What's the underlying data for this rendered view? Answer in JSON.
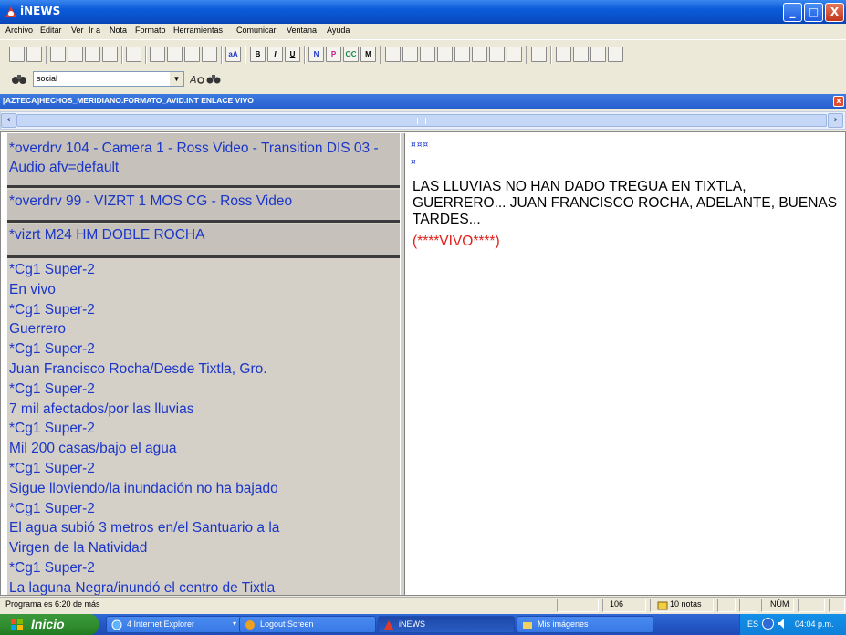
{
  "window": {
    "title": "iNEWS",
    "controls": {
      "minimize": "_",
      "maximize": "□",
      "close": "X"
    }
  },
  "menu": [
    "Archivo",
    "Editar",
    "Ver",
    "Ir a",
    "Nota",
    "Formato",
    "Herramientas",
    "Comunicar",
    "Ventana",
    "Ayuda"
  ],
  "toolbar": {
    "format_buttons": [
      "B",
      "I",
      "U",
      "N",
      "P",
      "OC",
      "M"
    ],
    "search_combo_value": "social"
  },
  "document": {
    "title": "[AZTECA]HECHOS_MERIDIANO.FORMATO_AVID.INT ENLACE VIVO",
    "close_label": "x"
  },
  "production": {
    "cue1": "*overdrv 104 - Camera 1 - Ross Video - Transition DIS 03 - Audio afv=default",
    "cue2": "*overdrv 99 - VIZRT 1 MOS CG - Ross Video",
    "cue3": "*vizrt M24 HM DOBLE ROCHA",
    "cg_lines": [
      "*Cg1 Super-2",
      "En vivo",
      "*Cg1 Super-2",
      "Guerrero",
      "*Cg1 Super-2",
      "Juan Francisco Rocha/Desde Tixtla, Gro.",
      "*Cg1 Super-2",
      "7 mil afectados/por las lluvias",
      "*Cg1 Super-2",
      "Mil 200 casas/bajo el agua",
      "*Cg1 Super-2",
      "Sigue lloviendo/la inundación no ha bajado",
      "*Cg1 Super-2",
      "El agua subió 3 metros en/el Santuario a la",
      "Virgen de la Natividad",
      "*Cg1 Super-2",
      "La laguna Negra/inundó el centro de Tixtla"
    ]
  },
  "script": {
    "marker1": "¤¤¤",
    "marker2": "¤",
    "body": "LAS LLUVIAS NO HAN DADO TREGUA EN TIXTLA, GUERRERO... JUAN FRANCISCO ROCHA, ADELANTE, BUENAS TARDES...",
    "vivo": "(****VIVO****)"
  },
  "status": {
    "program": "Programa es 6:20 de más",
    "count": "106",
    "notes": "10 notas",
    "num": "NÚM"
  },
  "taskbar": {
    "start": "Inicio",
    "tasks": [
      "4 Internet Explorer",
      "Logout Screen",
      "iNEWS",
      "Mis imágenes"
    ],
    "tray": {
      "lang": "ES",
      "clock": "04:04 p.m."
    }
  },
  "colors": {
    "cue_text": "#1a35c8",
    "vivo_text": "#e0201a",
    "title_bar": "#0a5ad8"
  }
}
